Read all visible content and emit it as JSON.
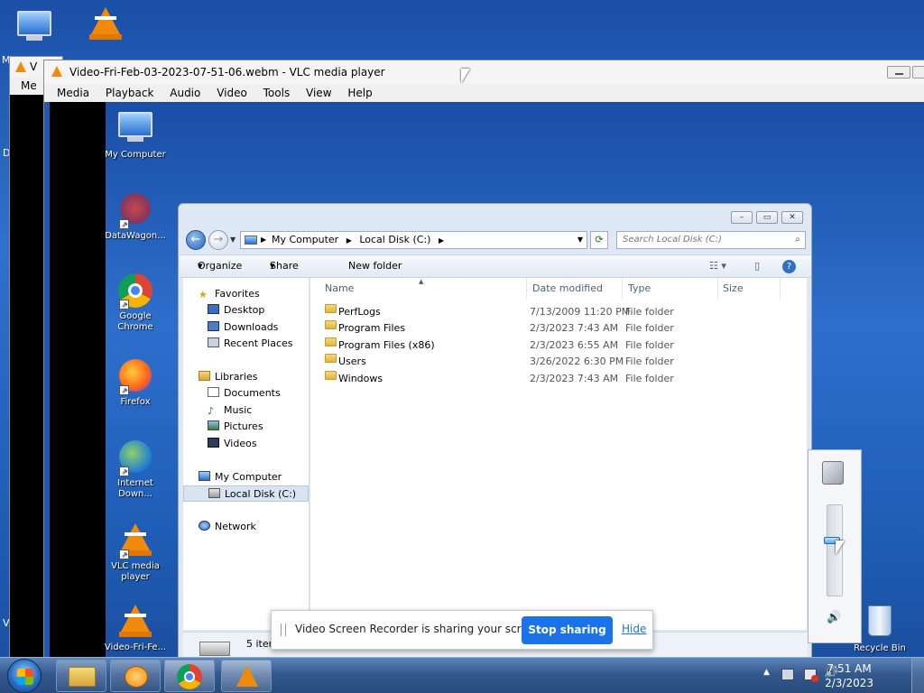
{
  "desktop": {
    "icon_my_computer": "My Computer",
    "icon_datawagon": "DataWagon...",
    "icon_chrome": "Google Chrome",
    "icon_firefox": "Firefox",
    "icon_idm": "Internet Down...",
    "icon_vlc": "VLC media player",
    "icon_video": "Video-Fri-Fe...",
    "icon_recycle": "Recycle Bin",
    "left_edge_fragment_1": "M",
    "left_edge_fragment_2": "D",
    "left_edge_fragment_3": "V"
  },
  "back_vlc": {
    "title_fragment": "V",
    "menu_fragment": "Me"
  },
  "vlc": {
    "title": "Video-Fri-Feb-03-2023-07-51-06.webm - VLC media player",
    "menu": [
      "Media",
      "Playback",
      "Audio",
      "Video",
      "Tools",
      "View",
      "Help"
    ]
  },
  "explorer": {
    "breadcrumb": [
      "My Computer",
      "Local Disk (C:)"
    ],
    "search_placeholder": "Search Local Disk (C:)",
    "commands": {
      "organize": "Organize",
      "share_with": "Share with",
      "new_folder": "New folder"
    },
    "nav": {
      "favorites": "Favorites",
      "desktop": "Desktop",
      "downloads": "Downloads",
      "recent": "Recent Places",
      "libraries": "Libraries",
      "documents": "Documents",
      "music": "Music",
      "pictures": "Pictures",
      "videos": "Videos",
      "my_computer": "My Computer",
      "local_disk": "Local Disk (C:)",
      "network": "Network"
    },
    "columns": {
      "name": "Name",
      "date": "Date modified",
      "type": "Type",
      "size": "Size"
    },
    "files": [
      {
        "name": "PerfLogs",
        "date": "7/13/2009 11:20 PM",
        "type": "File folder"
      },
      {
        "name": "Program Files",
        "date": "2/3/2023 7:43 AM",
        "type": "File folder"
      },
      {
        "name": "Program Files (x86)",
        "date": "2/3/2023 6:55 AM",
        "type": "File folder"
      },
      {
        "name": "Users",
        "date": "3/26/2022 6:30 PM",
        "type": "File folder"
      },
      {
        "name": "Windows",
        "date": "2/3/2023 7:43 AM",
        "type": "File folder"
      }
    ],
    "status": "5 item"
  },
  "sharing": {
    "message": "Video Screen Recorder is sharing your screen.",
    "stop": "Stop sharing",
    "hide": "Hide"
  },
  "volume": {
    "level": 0.62
  },
  "taskbar": {
    "time": "7:51 AM",
    "date": "2/3/2023"
  },
  "colors": {
    "accent": "#1a73e8",
    "taskbar": "#35598f",
    "desktop": "#2060b8"
  }
}
